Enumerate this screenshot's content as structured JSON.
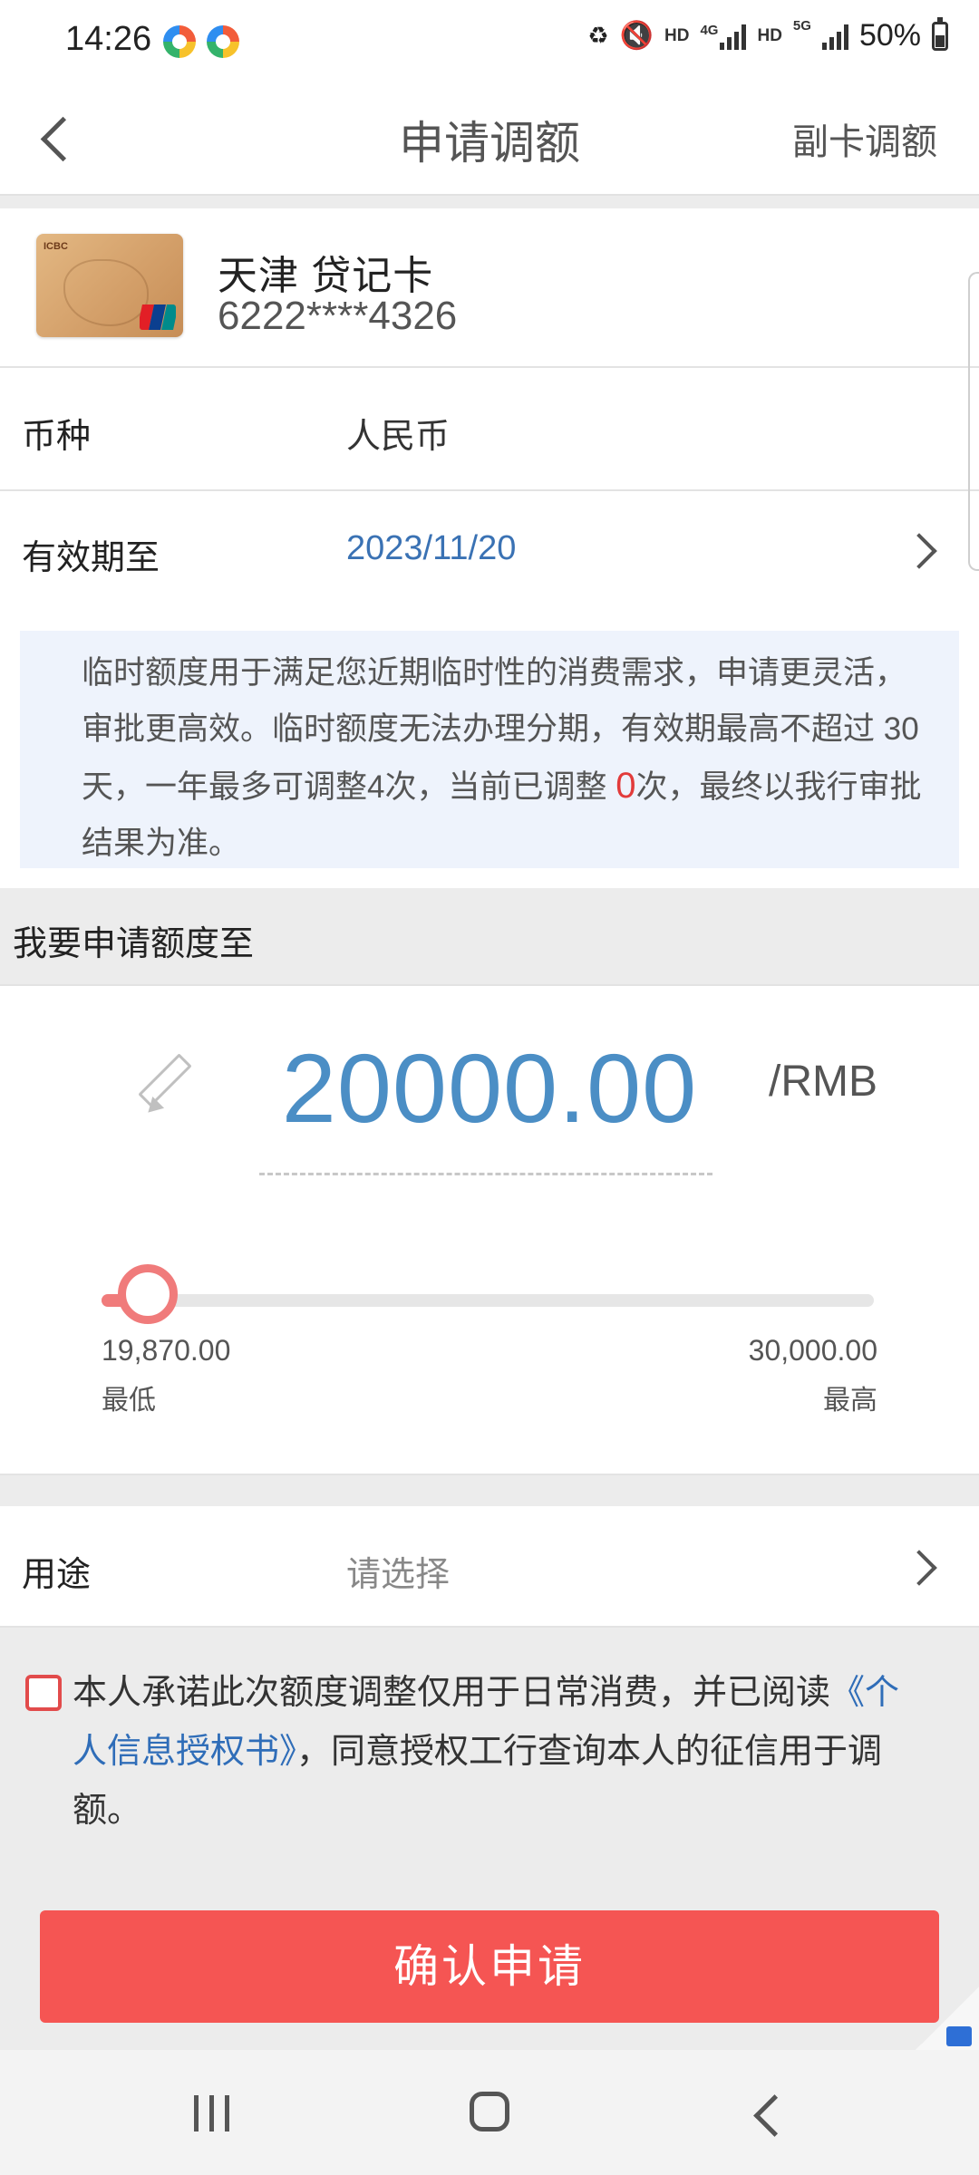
{
  "status_bar": {
    "time": "14:26",
    "hd1": "HD",
    "net1": "4G",
    "hd2": "HD",
    "net2": "5G",
    "battery": "50%"
  },
  "header": {
    "title": "申请调额",
    "right_action": "副卡调额"
  },
  "card": {
    "logo_text": "ICBC",
    "name": "天津  贷记卡",
    "number": "6222****4326"
  },
  "currency": {
    "label": "币种",
    "value": "人民币"
  },
  "validity": {
    "label": "有效期至",
    "value": "2023/11/20"
  },
  "notice": {
    "text_before": "临时额度用于满足您近期临时性的消费需求，申请更灵活，审批更高效。临时额度无法办理分期，有效期最高不超过 30天，一年最多可调整4次，当前已调整 ",
    "count": "0",
    "text_after": "次，最终以我行审批结果为准。"
  },
  "amount_section": {
    "header": "我要申请额度至",
    "amount": "20000.00",
    "unit": "/RMB"
  },
  "slider": {
    "min_value": "19,870.00",
    "min_label": "最低",
    "max_value": "30,000.00",
    "max_label": "最高",
    "min": 19870,
    "max": 30000,
    "current": 20000
  },
  "usage": {
    "label": "用途",
    "placeholder": "请选择"
  },
  "agreement": {
    "text_before": "本人承诺此次额度调整仅用于日常消费，并已阅读",
    "link": "《个人信息授权书》",
    "text_after": "，同意授权工行查询本人的征信用于调额。",
    "checked": false
  },
  "confirm_button": "确认申请",
  "colors": {
    "accent_red": "#f55553",
    "amount_blue": "#4b8ec5",
    "link_blue": "#2f6db8"
  },
  "icons": {
    "back": "chevron-left-icon",
    "edit": "pencil-icon",
    "row_arrow": "chevron-right-icon",
    "nav_recent": "recent-apps-icon",
    "nav_home": "home-icon",
    "nav_back": "back-icon"
  }
}
